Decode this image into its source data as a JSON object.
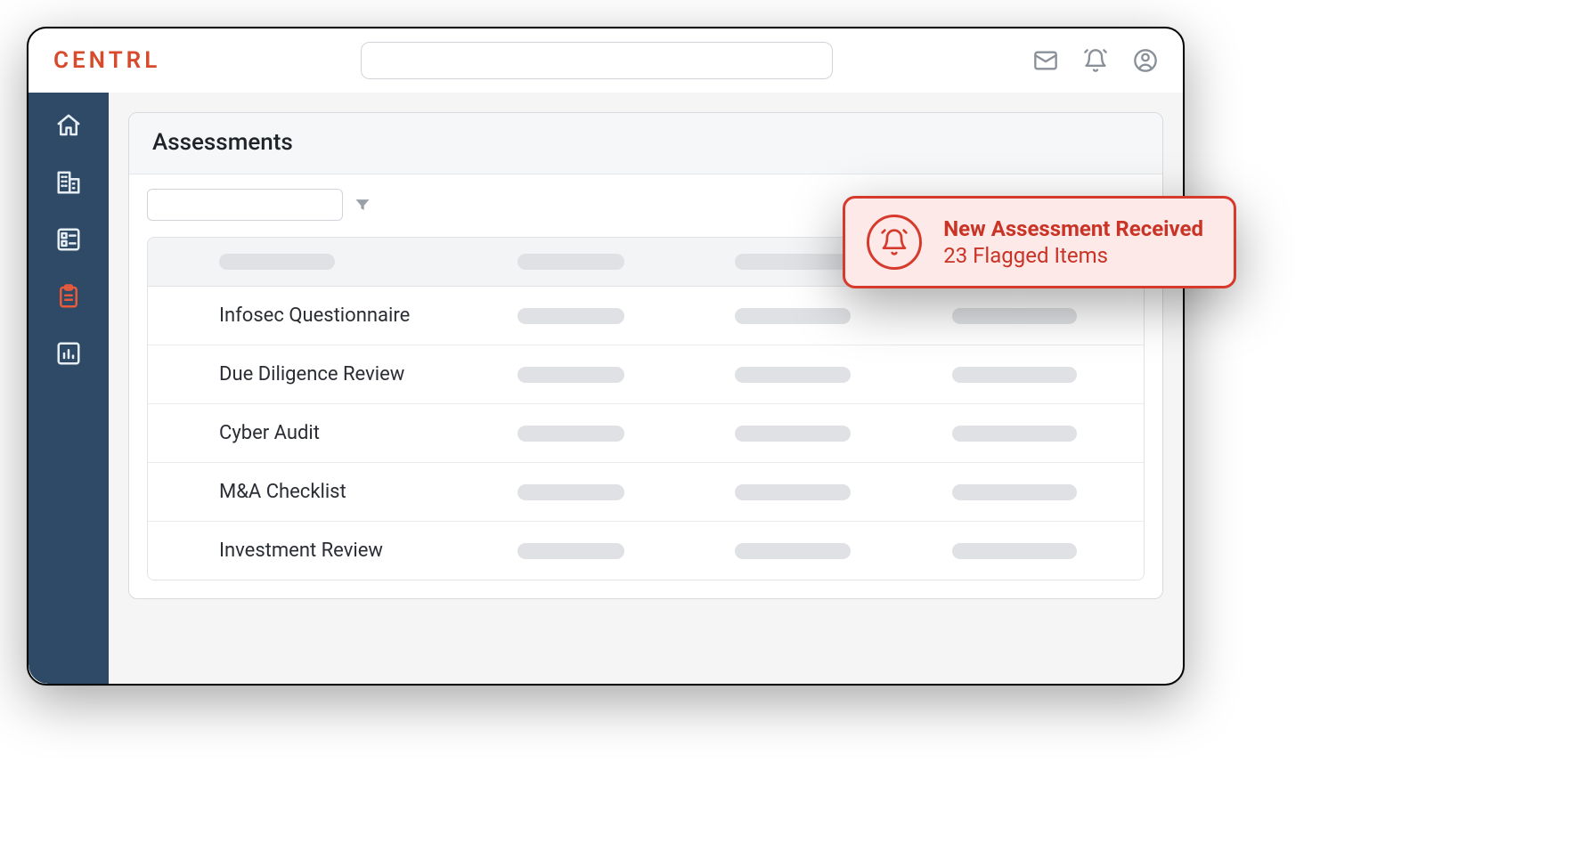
{
  "brand": {
    "logo_text": "CENTRL",
    "color": "#d84a2c"
  },
  "topbar": {
    "search_placeholder": "",
    "icons": {
      "mail": "mail-icon",
      "bell": "bell-icon",
      "user": "user-circle-icon"
    }
  },
  "sidebar": {
    "items": [
      {
        "name": "home",
        "active": false
      },
      {
        "name": "org",
        "active": false
      },
      {
        "name": "tasks",
        "active": false
      },
      {
        "name": "assessments",
        "active": true
      },
      {
        "name": "reports",
        "active": false
      }
    ]
  },
  "panel": {
    "title": "Assessments",
    "filter_placeholder": ""
  },
  "table": {
    "rows": [
      {
        "name": "Infosec Questionnaire"
      },
      {
        "name": "Due Diligence Review"
      },
      {
        "name": "Cyber Audit"
      },
      {
        "name": "M&A Checklist"
      },
      {
        "name": "Investment Review"
      }
    ]
  },
  "toast": {
    "title": "New Assessment Received",
    "subtitle": "23 Flagged Items",
    "accent": "#d63a2c"
  }
}
